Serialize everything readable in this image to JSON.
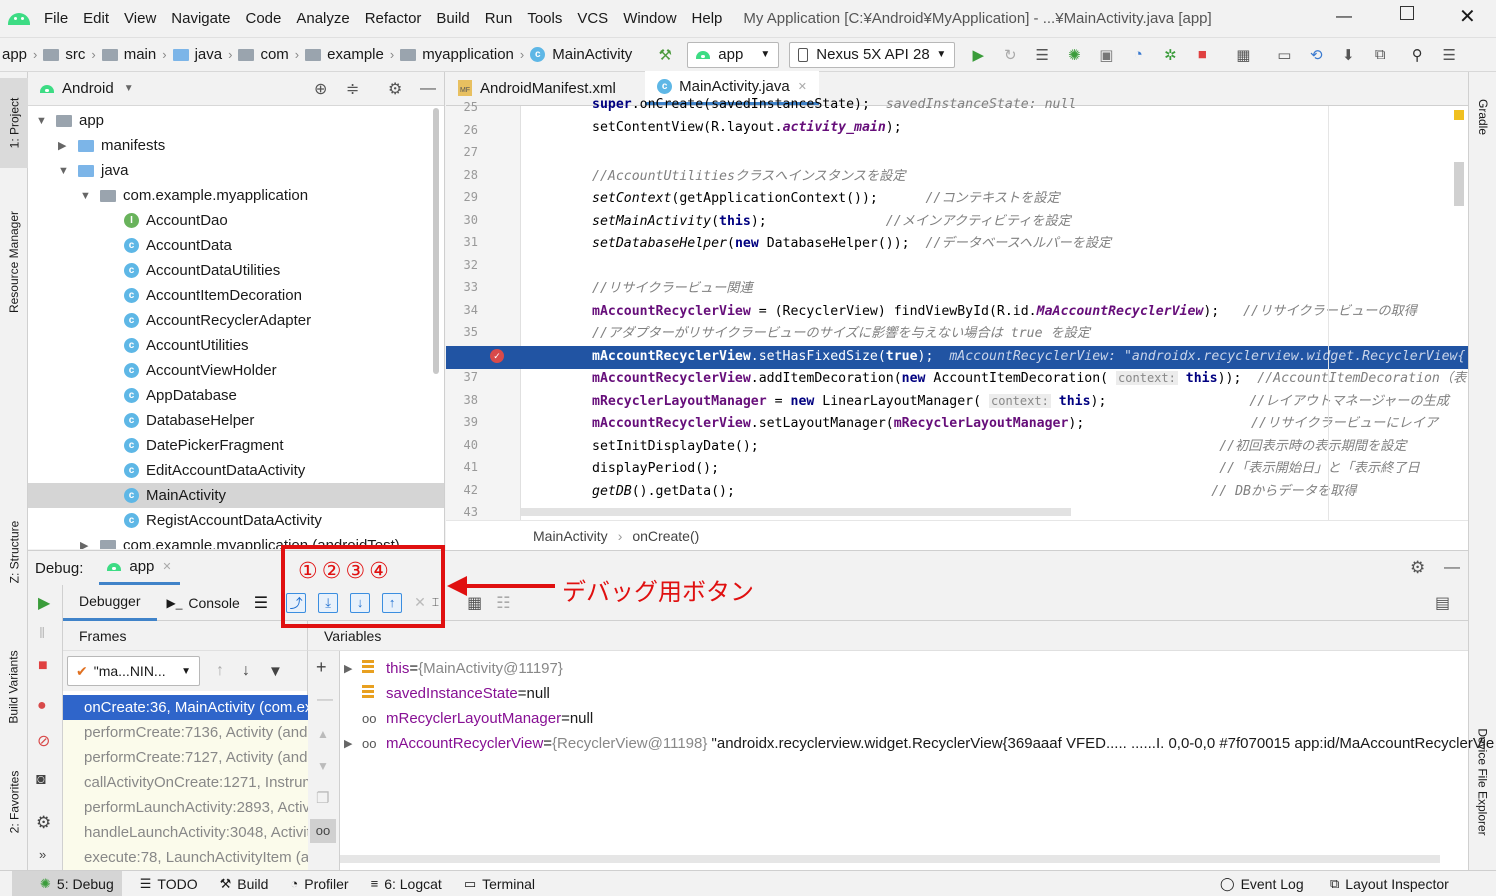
{
  "menu": [
    "File",
    "Edit",
    "View",
    "Navigate",
    "Code",
    "Analyze",
    "Refactor",
    "Build",
    "Run",
    "Tools",
    "VCS",
    "Window",
    "Help"
  ],
  "window_title": "My Application [C:¥Android¥MyApplication] - ...¥MainActivity.java [app]",
  "breadcrumbs": [
    "app",
    "src",
    "main",
    "java",
    "com",
    "example",
    "myapplication",
    "MainActivity"
  ],
  "run_config": "app",
  "device": "Nexus 5X API 28",
  "project_view": "Android",
  "tree": [
    {
      "label": "app",
      "level": 0,
      "kind": "module",
      "expanded": true
    },
    {
      "label": "manifests",
      "level": 1,
      "kind": "folder",
      "expanded": false
    },
    {
      "label": "java",
      "level": 1,
      "kind": "folder",
      "expanded": true
    },
    {
      "label": "com.example.myapplication",
      "level": 2,
      "kind": "package",
      "expanded": true
    },
    {
      "label": "AccountDao",
      "level": 3,
      "kind": "interface"
    },
    {
      "label": "AccountData",
      "level": 3,
      "kind": "class"
    },
    {
      "label": "AccountDataUtilities",
      "level": 3,
      "kind": "class"
    },
    {
      "label": "AccountItemDecoration",
      "level": 3,
      "kind": "class"
    },
    {
      "label": "AccountRecyclerAdapter",
      "level": 3,
      "kind": "class"
    },
    {
      "label": "AccountUtilities",
      "level": 3,
      "kind": "class"
    },
    {
      "label": "AccountViewHolder",
      "level": 3,
      "kind": "class"
    },
    {
      "label": "AppDatabase",
      "level": 3,
      "kind": "class"
    },
    {
      "label": "DatabaseHelper",
      "level": 3,
      "kind": "class"
    },
    {
      "label": "DatePickerFragment",
      "level": 3,
      "kind": "class"
    },
    {
      "label": "EditAccountDataActivity",
      "level": 3,
      "kind": "class"
    },
    {
      "label": "MainActivity",
      "level": 3,
      "kind": "class",
      "selected": true
    },
    {
      "label": "RegistAccountDataActivity",
      "level": 3,
      "kind": "class"
    },
    {
      "label": "com.example.myapplication (androidTest)",
      "level": 2,
      "kind": "package",
      "expanded": false
    }
  ],
  "editor_tabs": [
    "AndroidManifest.xml",
    "MainActivity.java"
  ],
  "editor_breadcrumb": [
    "MainActivity",
    "onCreate()"
  ],
  "line_numbers": [
    "25",
    "26",
    "27",
    "28",
    "29",
    "30",
    "31",
    "32",
    "33",
    "34",
    "35",
    "36",
    "37",
    "38",
    "39",
    "40",
    "41",
    "42",
    "43"
  ],
  "current_line": "36",
  "left_tabs": [
    "1: Project",
    "Resource Manager",
    "Z: Structure",
    "Build Variants",
    "2: Favorites"
  ],
  "right_tabs": [
    "Gradle",
    "Device File Explorer"
  ],
  "debug": {
    "label": "Debug:",
    "session": "app",
    "tabs": [
      "Debugger",
      "Console"
    ],
    "frames_label": "Frames",
    "variables_label": "Variables",
    "thread": "\"ma...NIN...",
    "frames": [
      "onCreate:36, MainActivity (com.ex",
      "performCreate:7136, Activity (and",
      "performCreate:7127, Activity (and",
      "callActivityOnCreate:1271, Instrum",
      "performLaunchActivity:2893, Activi",
      "handleLaunchActivity:3048, Activit",
      "execute:78, LaunchActivityItem (an"
    ],
    "variables": [
      {
        "name": "this",
        "value": "{MainActivity@11197}",
        "expandable": true,
        "icon": "field-icon"
      },
      {
        "name": "savedInstanceState",
        "value": "null",
        "expandable": false,
        "icon": "field-icon"
      },
      {
        "name": "mRecyclerLayoutManager",
        "value": "null",
        "expandable": false,
        "icon": "watch-icon"
      },
      {
        "name": "mAccountRecyclerView",
        "value": "{RecyclerView@11198} \"androidx.recyclerview.widget.RecyclerView{369aaaf VFED..... ......I. 0,0-0,0 #7f070015 app:id/MaAccountRecyclerVie",
        "expandable": true,
        "icon": "watch-icon"
      }
    ]
  },
  "annotation": {
    "numbers": "①②③④",
    "text": "デバッグ用ボタン"
  },
  "statusbar": {
    "left": [
      "5: Debug",
      "TODO",
      "Build",
      "Profiler",
      "6: Logcat",
      "Terminal"
    ],
    "right": [
      "Event Log",
      "Layout Inspector"
    ]
  },
  "colors": {
    "exec_line": "#2154a3",
    "annotation": "#e01010",
    "selected_frame": "#2f65ca",
    "android_green": "#3ddc84"
  }
}
